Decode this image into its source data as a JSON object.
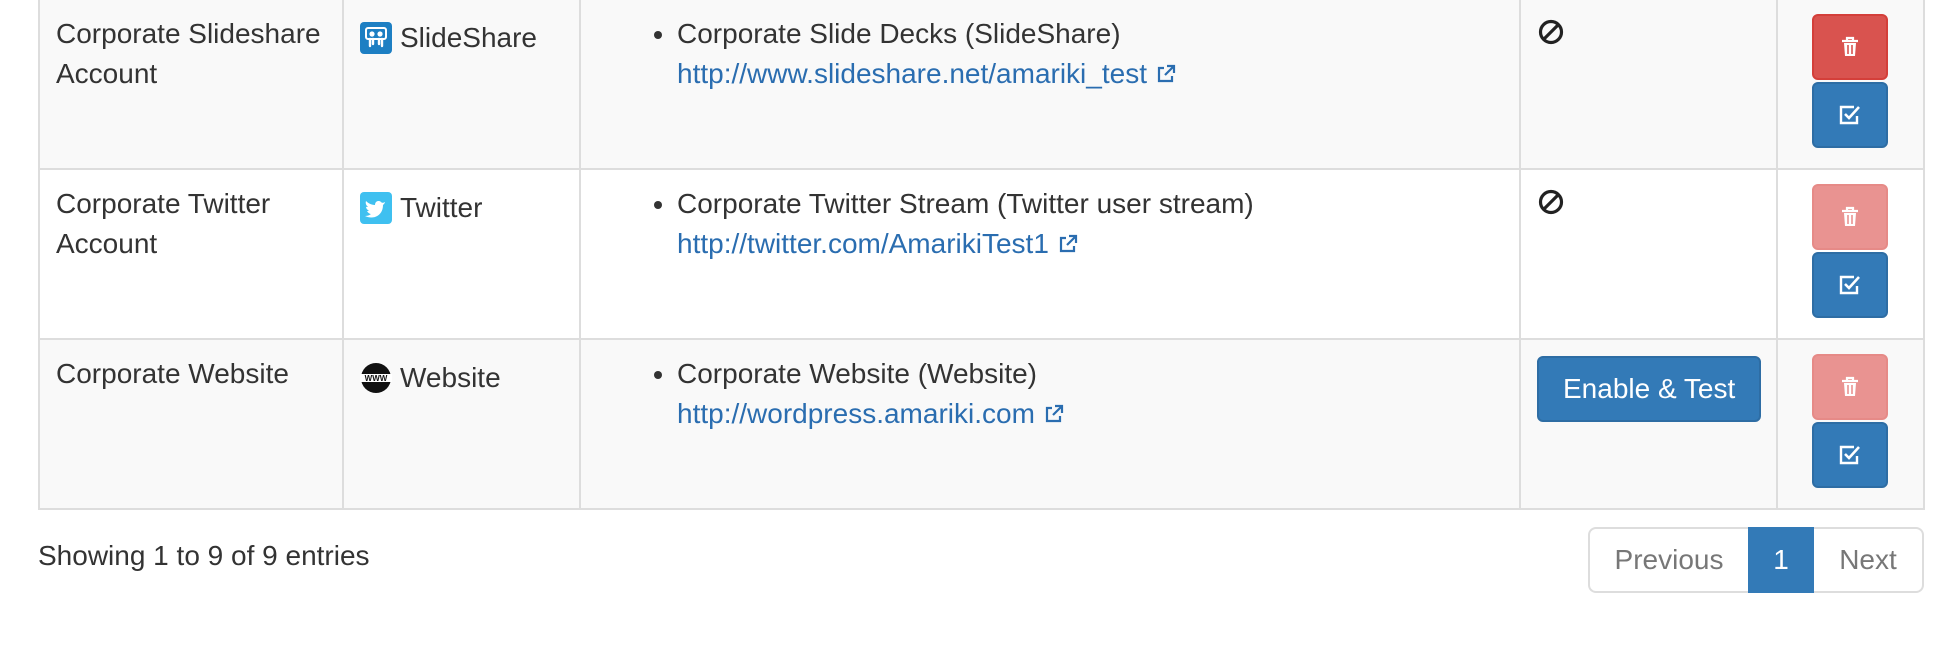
{
  "rows": [
    {
      "name": "Corporate Slideshare Account",
      "type_label": "SlideShare",
      "type_icon": "slideshare-icon",
      "feed_title": "Corporate Slide Decks (SlideShare)",
      "feed_url": "http://www.slideshare.net/amariki_test",
      "status": "disabled-icon",
      "delete_enabled": true
    },
    {
      "name": "Corporate Twitter Account",
      "type_label": "Twitter",
      "type_icon": "twitter-icon",
      "feed_title": "Corporate Twitter Stream (Twitter user stream)",
      "feed_url": "http://twitter.com/AmarikiTest1",
      "status": "disabled-icon",
      "delete_enabled": false
    },
    {
      "name": "Corporate Website",
      "type_label": "Website",
      "type_icon": "www-icon",
      "feed_title": "Corporate Website (Website)",
      "feed_url": "http://wordpress.amariki.com",
      "status_button": "Enable & Test",
      "delete_enabled": false
    }
  ],
  "footer": {
    "info": "Showing 1 to 9 of 9 entries",
    "pagination": {
      "previous": "Previous",
      "current": "1",
      "next": "Next"
    }
  },
  "colors": {
    "primary": "#337ab7",
    "danger": "#d9534f",
    "danger_disabled": "#e99391",
    "link": "#2a6db0"
  }
}
